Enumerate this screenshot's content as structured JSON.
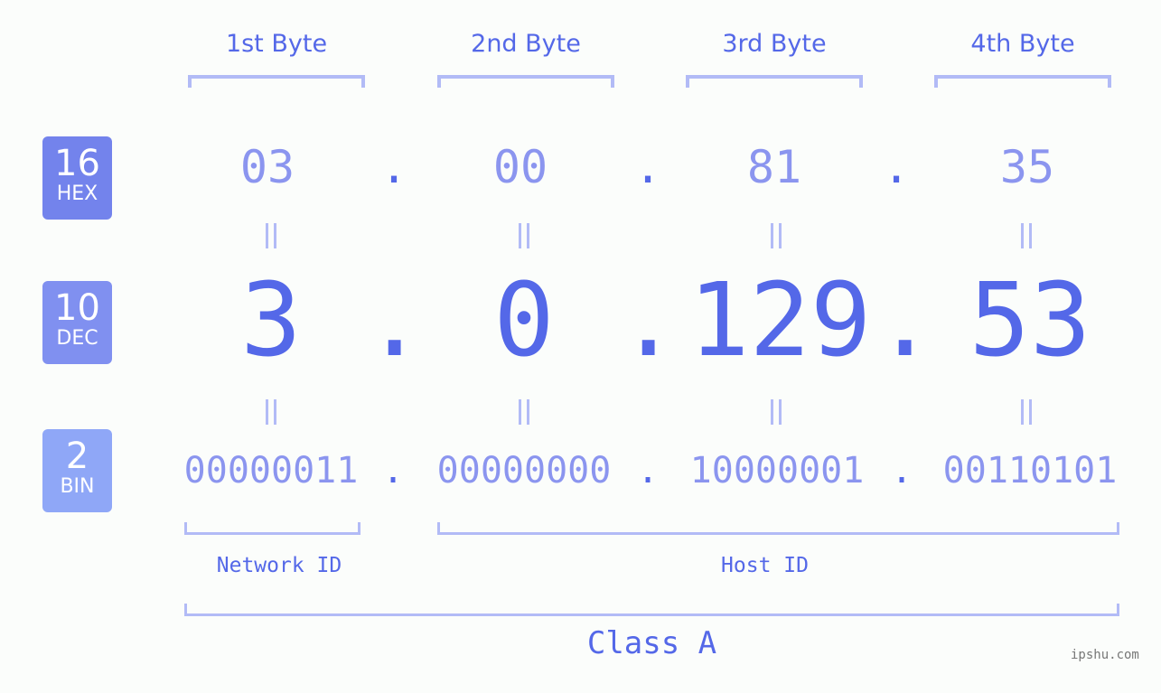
{
  "headers": [
    "1st Byte",
    "2nd Byte",
    "3rd Byte",
    "4th Byte"
  ],
  "badges": [
    {
      "num": "16",
      "label": "HEX",
      "color": "#7383ec"
    },
    {
      "num": "10",
      "label": "DEC",
      "color": "#8090f0"
    },
    {
      "num": "2",
      "label": "BIN",
      "color": "#8fa7f7"
    }
  ],
  "hex": [
    "03",
    "00",
    "81",
    "35"
  ],
  "dec": [
    "3",
    "0",
    "129",
    "53"
  ],
  "bin": [
    "00000011",
    "00000000",
    "10000001",
    "00110101"
  ],
  "separator": ".",
  "network_id_label": "Network ID",
  "host_id_label": "Host ID",
  "class_label": "Class A",
  "watermark": "ipshu.com",
  "colors": {
    "accent": "#5468e8",
    "light": "#8b95ef",
    "bracket": "#b2bbf6",
    "background": "#fbfdfb"
  }
}
